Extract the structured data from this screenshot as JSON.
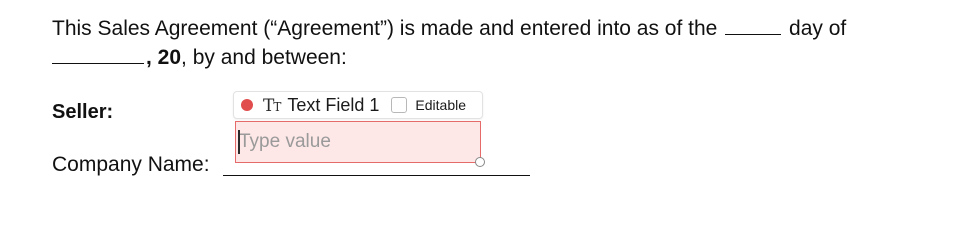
{
  "document": {
    "line1": {
      "text_before_blank": "This Sales Agreement (“Agreement”) is made and entered into as of the",
      "text_after_blank": "day of"
    },
    "line2": {
      "year_prefix": "20",
      "text_after_year": ", by and between:"
    },
    "seller_label": "Seller:",
    "company_label": "Company Name:"
  },
  "field": {
    "status_color": "#e14d4d",
    "type_icon": "text-field-icon",
    "name": "Text Field 1",
    "editable_label": "Editable",
    "editable_checked": false,
    "placeholder": "Type value",
    "value": "",
    "border_color": "#e66a6a",
    "fill_color": "#fde7e7"
  }
}
